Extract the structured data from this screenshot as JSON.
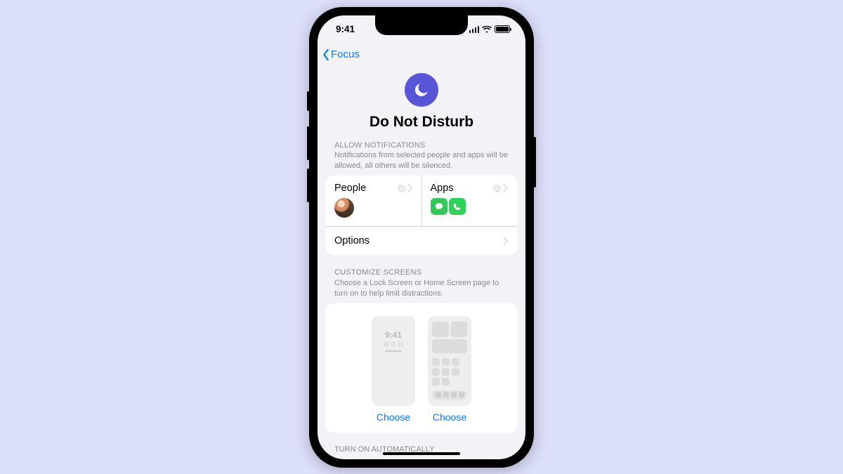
{
  "status": {
    "time": "9:41"
  },
  "nav": {
    "back_label": "Focus"
  },
  "hero": {
    "title": "Do Not Disturb"
  },
  "allow": {
    "header": "ALLOW NOTIFICATIONS",
    "desc": "Notifications from selected people and apps will be allowed, all others will be silenced.",
    "people_label": "People",
    "apps_label": "Apps",
    "options_label": "Options"
  },
  "customize": {
    "header": "CUSTOMIZE SCREENS",
    "desc": "Choose a Lock Screen or Home Screen page to turn on to help limit distractions.",
    "lock_time": "9:41",
    "choose_lock": "Choose",
    "choose_home": "Choose"
  },
  "auto": {
    "header": "TURN ON AUTOMATICALLY"
  }
}
